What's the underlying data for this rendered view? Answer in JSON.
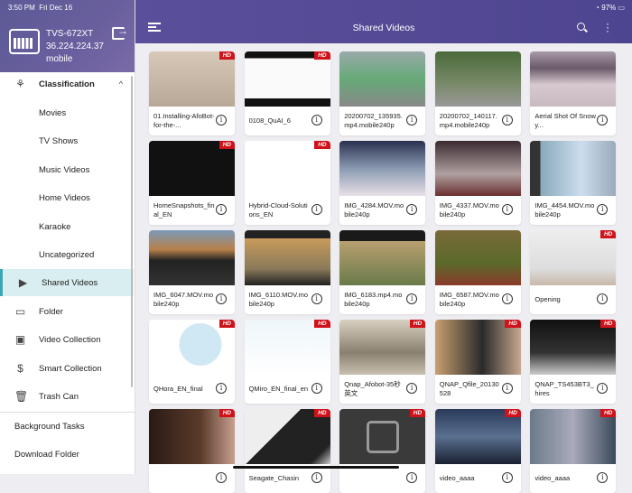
{
  "status": {
    "time": "3:50 PM",
    "date": "Fri Dec 16",
    "battery": "97%"
  },
  "device": {
    "name": "TVS-672XT",
    "ip": "36.224.224.37",
    "user": "mobile"
  },
  "header": {
    "title": "Shared Videos"
  },
  "sidebar": {
    "items": [
      {
        "label": "Classification",
        "icon": "classification-icon"
      },
      {
        "label": "Movies"
      },
      {
        "label": "TV Shows"
      },
      {
        "label": "Music Videos"
      },
      {
        "label": "Home Videos"
      },
      {
        "label": "Karaoke"
      },
      {
        "label": "Uncategorized"
      },
      {
        "label": "Shared Videos",
        "icon": "shared-videos-icon",
        "selected": true
      },
      {
        "label": "Folder",
        "icon": "folder-icon"
      },
      {
        "label": "Video Collection",
        "icon": "video-collection-icon"
      },
      {
        "label": "Smart Collection",
        "icon": "smart-collection-icon"
      },
      {
        "label": "Trash Can",
        "icon": "trash-icon"
      }
    ],
    "bottom": [
      {
        "label": "Background Tasks"
      },
      {
        "label": "Download Folder"
      }
    ]
  },
  "videos": [
    {
      "title": "01.Installing-AfoBot-for-the-...",
      "hd": true,
      "bg": "linear-gradient(#d8c8b8,#b8a898)"
    },
    {
      "title": "0108_QuAI_6",
      "hd": true,
      "bg": "linear-gradient(#111 0 12%,#fafafa 12% 85%,#111 85%)"
    },
    {
      "title": "20200702_135935.mp4.mobile240p",
      "hd": false,
      "bg": "linear-gradient(#9aa 0,#6a7 50%,#888 100%)"
    },
    {
      "title": "20200702_140117.mp4.mobile240p",
      "hd": false,
      "bg": "linear-gradient(#4a6a3a,#7a8a6a 60%,#999)"
    },
    {
      "title": "Aerial Shot Of Snowy...",
      "hd": false,
      "bg": "linear-gradient(#a99aa8,#6a5a6a 30%,#d8c8d0 60%,#c8b8c0)"
    },
    {
      "title": "HomeSnapshots_final_EN",
      "hd": true,
      "bg": "#111"
    },
    {
      "title": "Hybrid-Cloud-Solutions_EN",
      "hd": true,
      "bg": "#fff"
    },
    {
      "title": "IMG_4284.MOV.mobile240p",
      "hd": false,
      "bg": "linear-gradient(#2a3050,#8a9ab0 50%,#e8e0e8)"
    },
    {
      "title": "IMG_4337.MOV.mobile240p",
      "hd": false,
      "bg": "linear-gradient(#3a2a30,#b0a0a0 60%,#6a3030)"
    },
    {
      "title": "IMG_4454.MOV.mobile240p",
      "hd": false,
      "bg": "linear-gradient(90deg,#333 0 12%,#8ab 12%,#cde 60%,#9ab)"
    },
    {
      "title": "IMG_6047.MOV.mobile240p",
      "hd": false,
      "bg": "linear-gradient(#7a9ab8,#b8804a 35%,#222 55%,#333)"
    },
    {
      "title": "IMG_6110.MOV.mobile240p",
      "hd": false,
      "bg": "linear-gradient(#222 0 15%,#c89a5a 15%,#8a7a5a 70%,#222)"
    },
    {
      "title": "IMG_6183.mp4.mobile240p",
      "hd": false,
      "bg": "linear-gradient(#1a1a1a 0 20%,#b8a070 20%,#6a7a4a)"
    },
    {
      "title": "IMG_6587.MOV.mobile240p",
      "hd": false,
      "bg": "linear-gradient(#7a6a3a,#5a6a2a 60%,#8a3a2a)"
    },
    {
      "title": "Opening",
      "hd": true,
      "bg": "linear-gradient(#eee,#ddd 70%,#c8b8a8)"
    },
    {
      "title": "QHora_EN_final",
      "hd": true,
      "bg": "radial-gradient(circle at 60% 45%,#cfe8f3 0 35%,#fff 36%)"
    },
    {
      "title": "QMiro_EN_final_en",
      "hd": true,
      "bg": "linear-gradient(#eef6fa,#fff)"
    },
    {
      "title": "Qnap_Afobot-35秒英文",
      "hd": true,
      "bg": "linear-gradient(#d8d0c0,#8a8070 60%,#c8c0b0)"
    },
    {
      "title": "QNAP_Qfile_20130528",
      "hd": true,
      "bg": "linear-gradient(90deg,#c8a070,#2a2a2a 55%,#c8a890)"
    },
    {
      "title": "QNAP_TS453BT3_hires",
      "hd": true,
      "bg": "linear-gradient(#111,#333 60%,#ccc)"
    },
    {
      "title": "",
      "hd": true,
      "bg": "linear-gradient(90deg,#2a1a14,#5a3a2a 60%,#c8a090)"
    },
    {
      "title": "Seagate_Chasin",
      "hd": true,
      "bg": "linear-gradient(135deg,#eee 0 40%,#222 40% 85%,#ccc)"
    },
    {
      "title": "",
      "hd": true,
      "bg": "#3a3a3a",
      "placeholder": true
    },
    {
      "title": "video_aaaa",
      "hd": true,
      "bg": "linear-gradient(#2a3a5a,#5a7090 50%,#1a2030)"
    },
    {
      "title": "video_aaaa",
      "hd": true,
      "bg": "linear-gradient(90deg,#6a7a8a,#aab 50%,#3a4a5a)"
    }
  ],
  "hd_label": "HD",
  "info_glyph": "i"
}
